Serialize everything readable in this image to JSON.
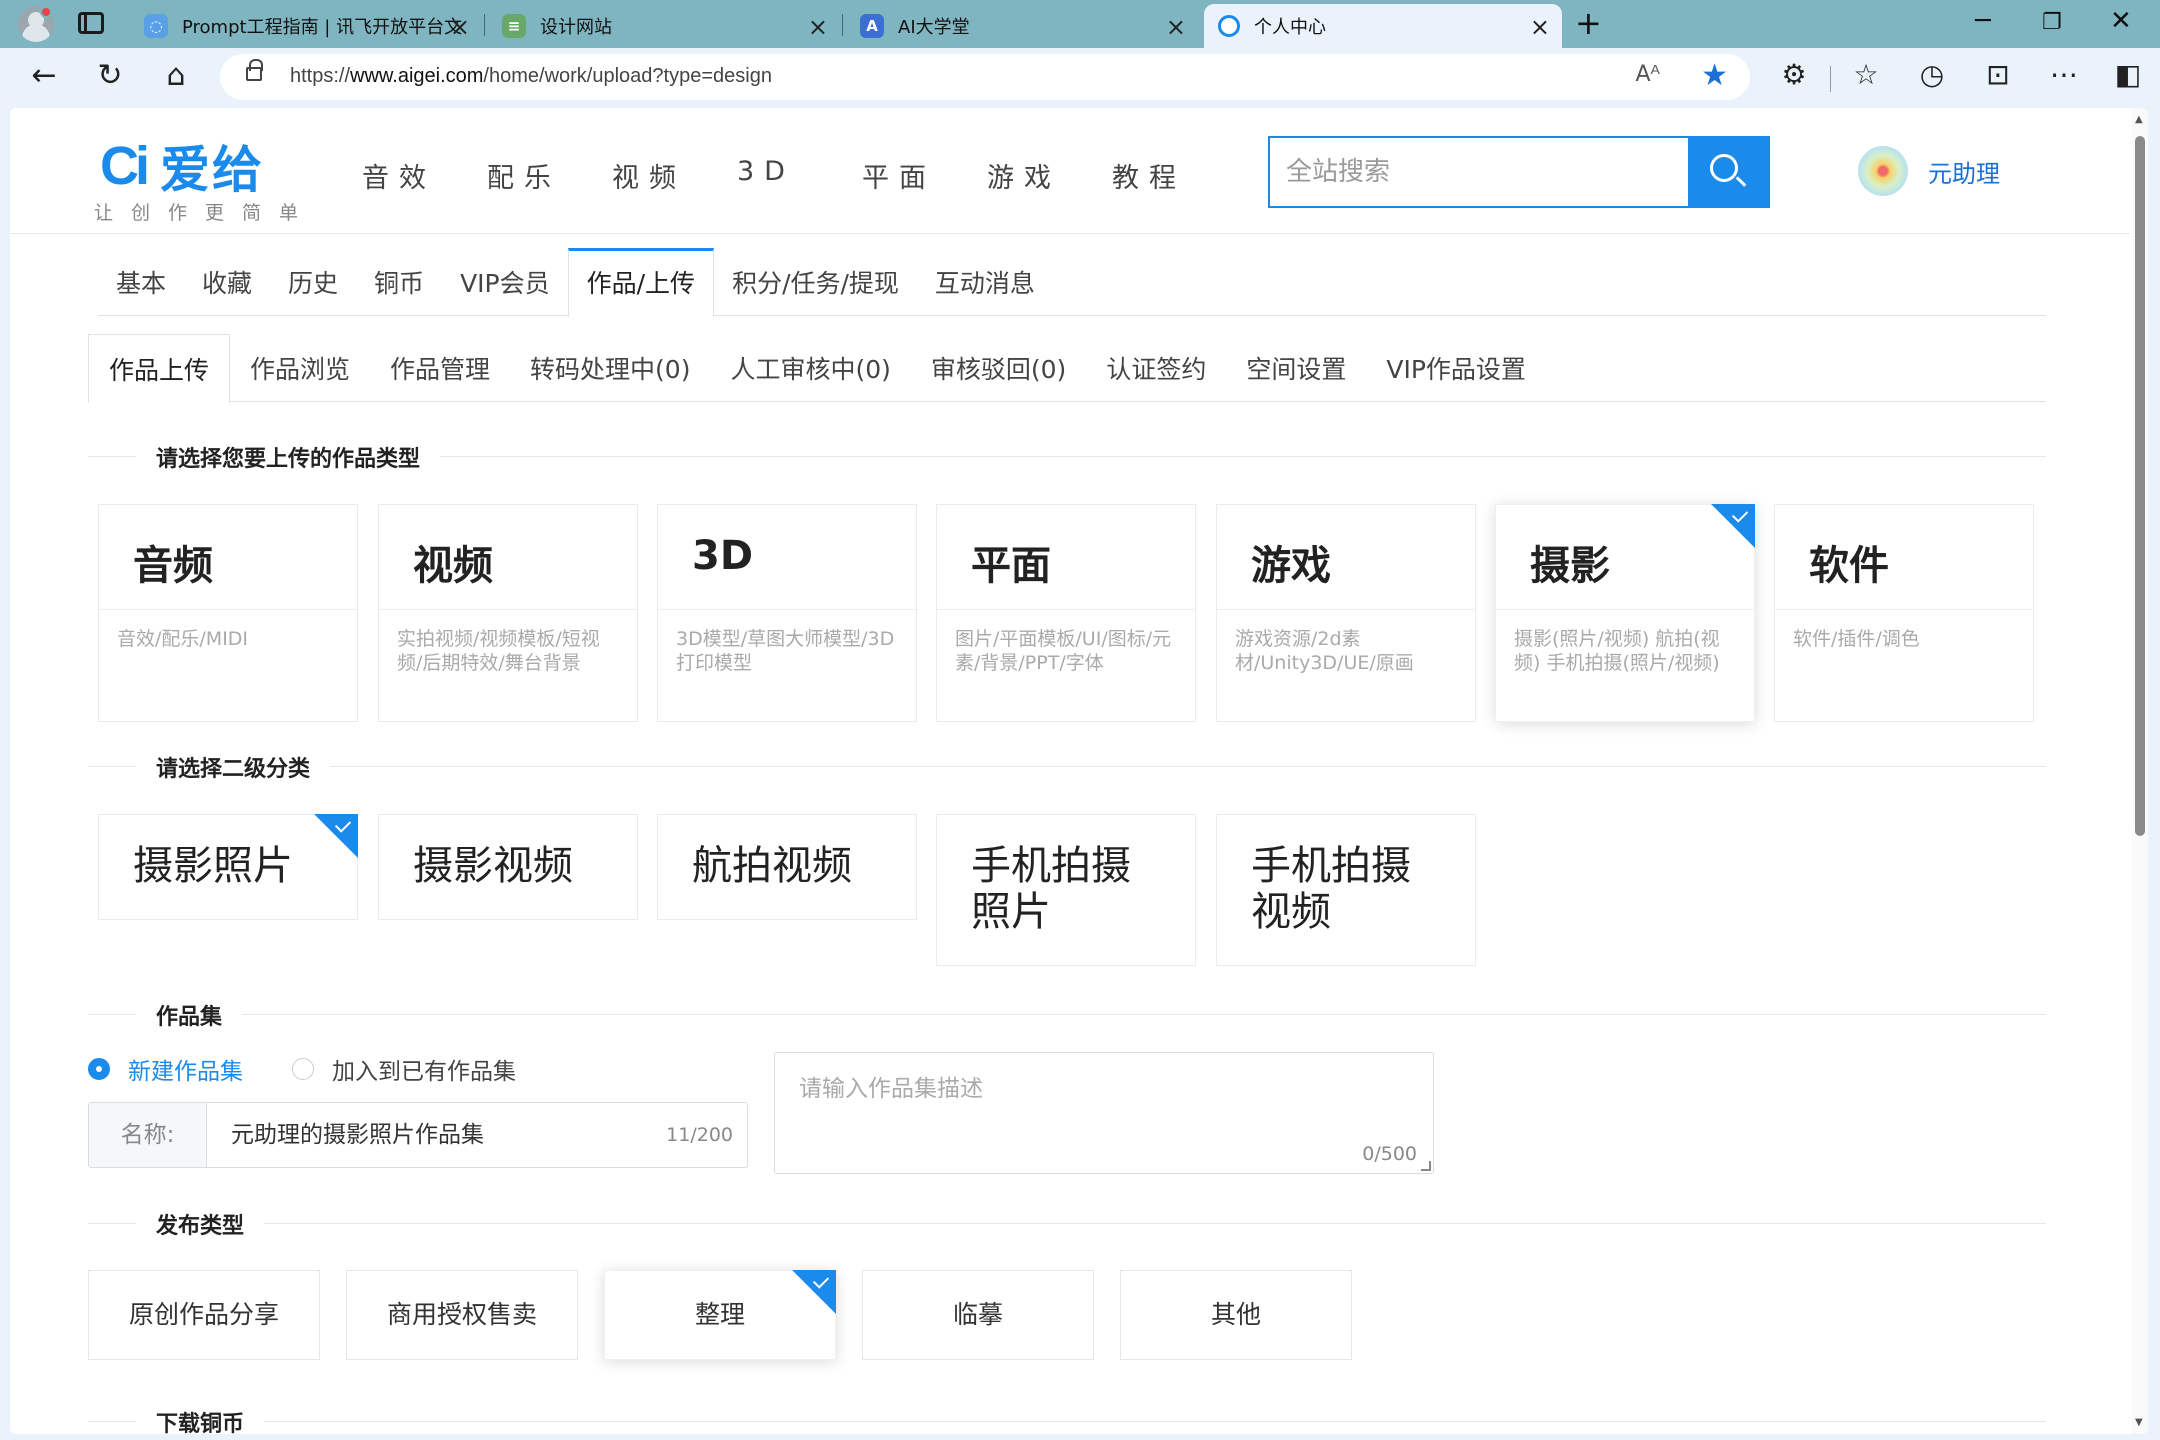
{
  "browser": {
    "tabs": [
      {
        "title": "Prompt工程指南 | 讯飞开放平台文档",
        "favicon": "xunfei-icon",
        "active": false
      },
      {
        "title": "设计网站",
        "favicon": "design-icon",
        "active": false
      },
      {
        "title": "AI大学堂",
        "favicon": "ai-icon",
        "active": false
      },
      {
        "title": "个人中心",
        "favicon": "aigei-icon",
        "active": true
      }
    ],
    "url_prefix": "https://",
    "url_domain": "www.aigei.com",
    "url_path": "/home/work/upload?type=design"
  },
  "site": {
    "logo_mark": "Ci",
    "logo_text": "爱给",
    "slogan": "让创作更简单",
    "nav": [
      "音效",
      "配乐",
      "视频",
      "3D",
      "平面",
      "游戏",
      "教程"
    ],
    "search_placeholder": "全站搜索",
    "username": "元助理"
  },
  "tabs_primary": [
    {
      "label": "基本",
      "active": false
    },
    {
      "label": "收藏",
      "active": false
    },
    {
      "label": "历史",
      "active": false
    },
    {
      "label": "铜币",
      "active": false
    },
    {
      "label": "VIP会员",
      "active": false
    },
    {
      "label": "作品/上传",
      "active": true
    },
    {
      "label": "积分/任务/提现",
      "active": false
    },
    {
      "label": "互动消息",
      "active": false
    }
  ],
  "tabs_secondary": [
    {
      "label": "作品上传",
      "active": true
    },
    {
      "label": "作品浏览",
      "active": false
    },
    {
      "label": "作品管理",
      "active": false
    },
    {
      "label": "转码处理中(0)",
      "active": false
    },
    {
      "label": "人工审核中(0)",
      "active": false
    },
    {
      "label": "审核驳回(0)",
      "active": false
    },
    {
      "label": "认证签约",
      "active": false
    },
    {
      "label": "空间设置",
      "active": false
    },
    {
      "label": "VIP作品设置",
      "active": false
    }
  ],
  "section_type": {
    "title": "请选择您要上传的作品类型",
    "cards": [
      {
        "title": "音频",
        "desc": "音效/配乐/MIDI",
        "selected": false
      },
      {
        "title": "视频",
        "desc": "实拍视频/视频模板/短视频/后期特效/舞台背景",
        "selected": false
      },
      {
        "title": "3D",
        "desc": "3D模型/草图大师模型/3D打印模型",
        "selected": false
      },
      {
        "title": "平面",
        "desc": "图片/平面模板/UI/图标/元素/背景/PPT/字体",
        "selected": false
      },
      {
        "title": "游戏",
        "desc": "游戏资源/2d素材/Unity3D/UE/原画",
        "selected": false
      },
      {
        "title": "摄影",
        "desc": "摄影(照片/视频) 航拍(视频) 手机拍摄(照片/视频)",
        "selected": true
      },
      {
        "title": "软件",
        "desc": "软件/插件/调色",
        "selected": false
      }
    ]
  },
  "section_sub": {
    "title": "请选择二级分类",
    "cards": [
      {
        "title": "摄影照片",
        "selected": true
      },
      {
        "title": "摄影视频",
        "selected": false
      },
      {
        "title": "航拍视频",
        "selected": false
      },
      {
        "title": "手机拍摄照片",
        "selected": false
      },
      {
        "title": "手机拍摄视频",
        "selected": false
      }
    ]
  },
  "section_collection": {
    "title": "作品集",
    "radio_new": "新建作品集",
    "radio_existing": "加入到已有作品集",
    "name_label": "名称:",
    "name_value": "元助理的摄影照片作品集",
    "name_count": "11/200",
    "desc_placeholder": "请输入作品集描述",
    "desc_count": "0/500"
  },
  "section_publish": {
    "title": "发布类型",
    "options": [
      {
        "label": "原创作品分享",
        "selected": false
      },
      {
        "label": "商用授权售卖",
        "selected": false
      },
      {
        "label": "整理",
        "selected": true
      },
      {
        "label": "临摹",
        "selected": false
      },
      {
        "label": "其他",
        "selected": false
      }
    ]
  },
  "section_coins": {
    "title": "下载铜币"
  },
  "colors": {
    "accent": "#1a8bea",
    "tabbar": "#7fb5c0"
  }
}
